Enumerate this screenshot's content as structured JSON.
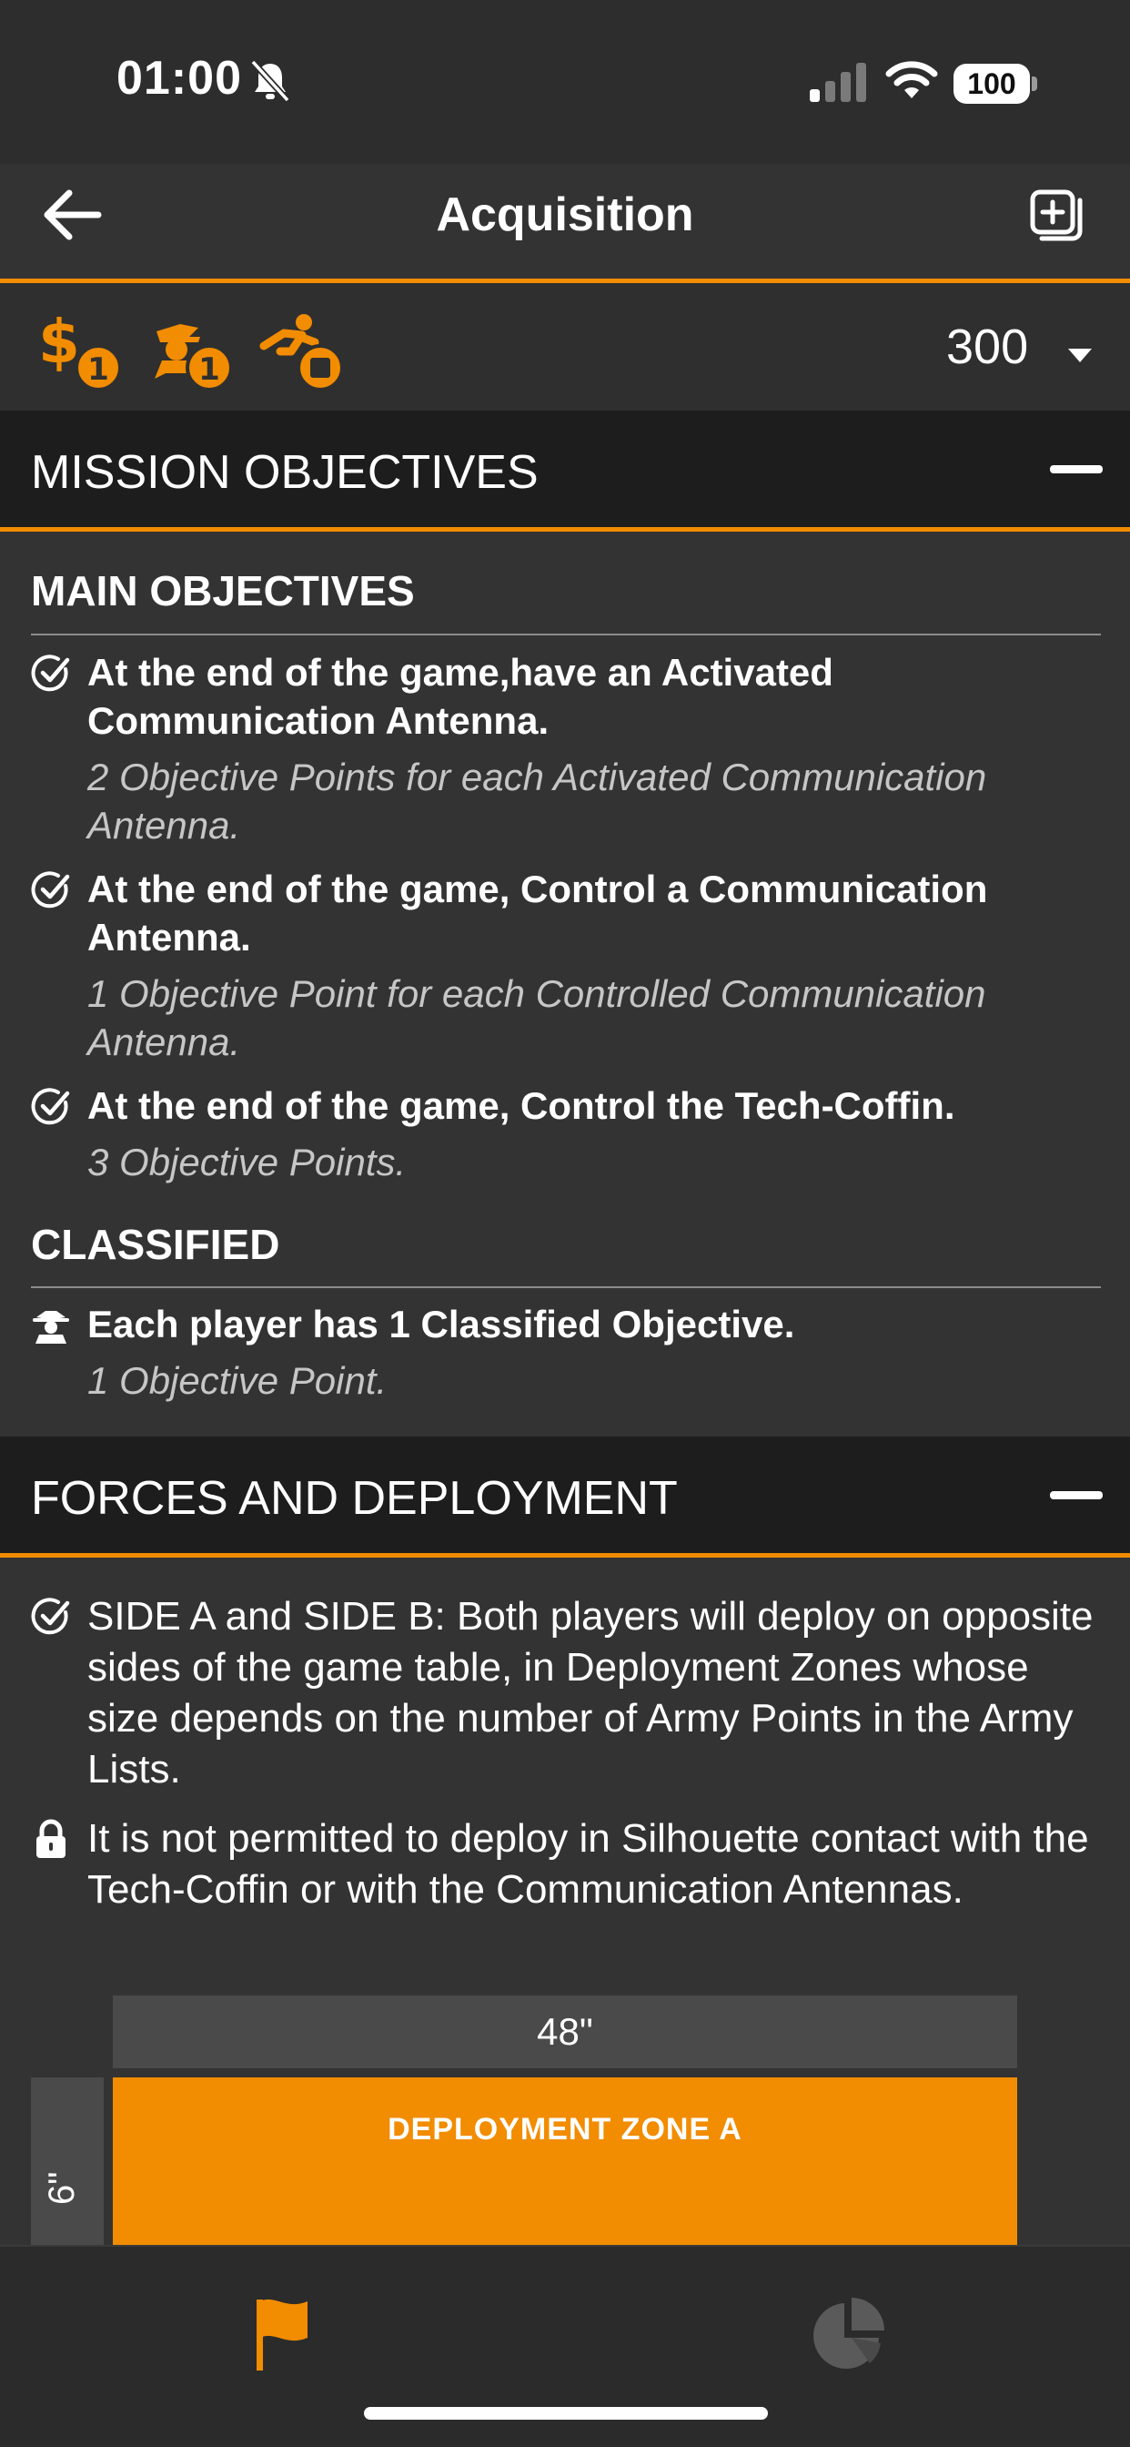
{
  "status": {
    "time": "01:00",
    "battery": "100"
  },
  "nav": {
    "title": "Acquisition"
  },
  "stats": {
    "points": "300",
    "badges": [
      {
        "icon": "money-icon",
        "count": "1"
      },
      {
        "icon": "spy-icon",
        "count": "1"
      },
      {
        "icon": "runner-icon",
        "count": ""
      }
    ]
  },
  "mission": {
    "title": "MISSION OBJECTIVES",
    "main_title": "MAIN OBJECTIVES",
    "objectives": [
      {
        "text": "At the end of the game,have an Activated Communication Antenna.",
        "points": "2 Objective Points for each Activated Communication Antenna."
      },
      {
        "text": "At the end of the game, Control a Communication Antenna.",
        "points": "1 Objective Point for each Controlled Communication Antenna."
      },
      {
        "text": "At the end of the game, Control the Tech-Coffin.",
        "points": "3 Objective Points."
      }
    ],
    "classified_title": "CLASSIFIED",
    "classified": {
      "text": "Each player has 1 Classified Objective.",
      "points": "1 Objective Point."
    }
  },
  "forces": {
    "title": "FORCES AND DEPLOYMENT",
    "rules": [
      "SIDE A and SIDE B: Both players will deploy on opposite sides of the game table, in Deployment Zones whose size depends on the number of Army Points in the Army Lists.",
      "It is not permitted to deploy in Silhouette contact with the Tech-Coffin or with the Communication Antennas."
    ],
    "map": {
      "width_label": "48\"",
      "depth_label": "6\"",
      "zone_a": "DEPLOYMENT ZONE A"
    }
  },
  "colors": {
    "accent": "#f28c00",
    "background": "#333333",
    "header": "#1d1d1d"
  }
}
